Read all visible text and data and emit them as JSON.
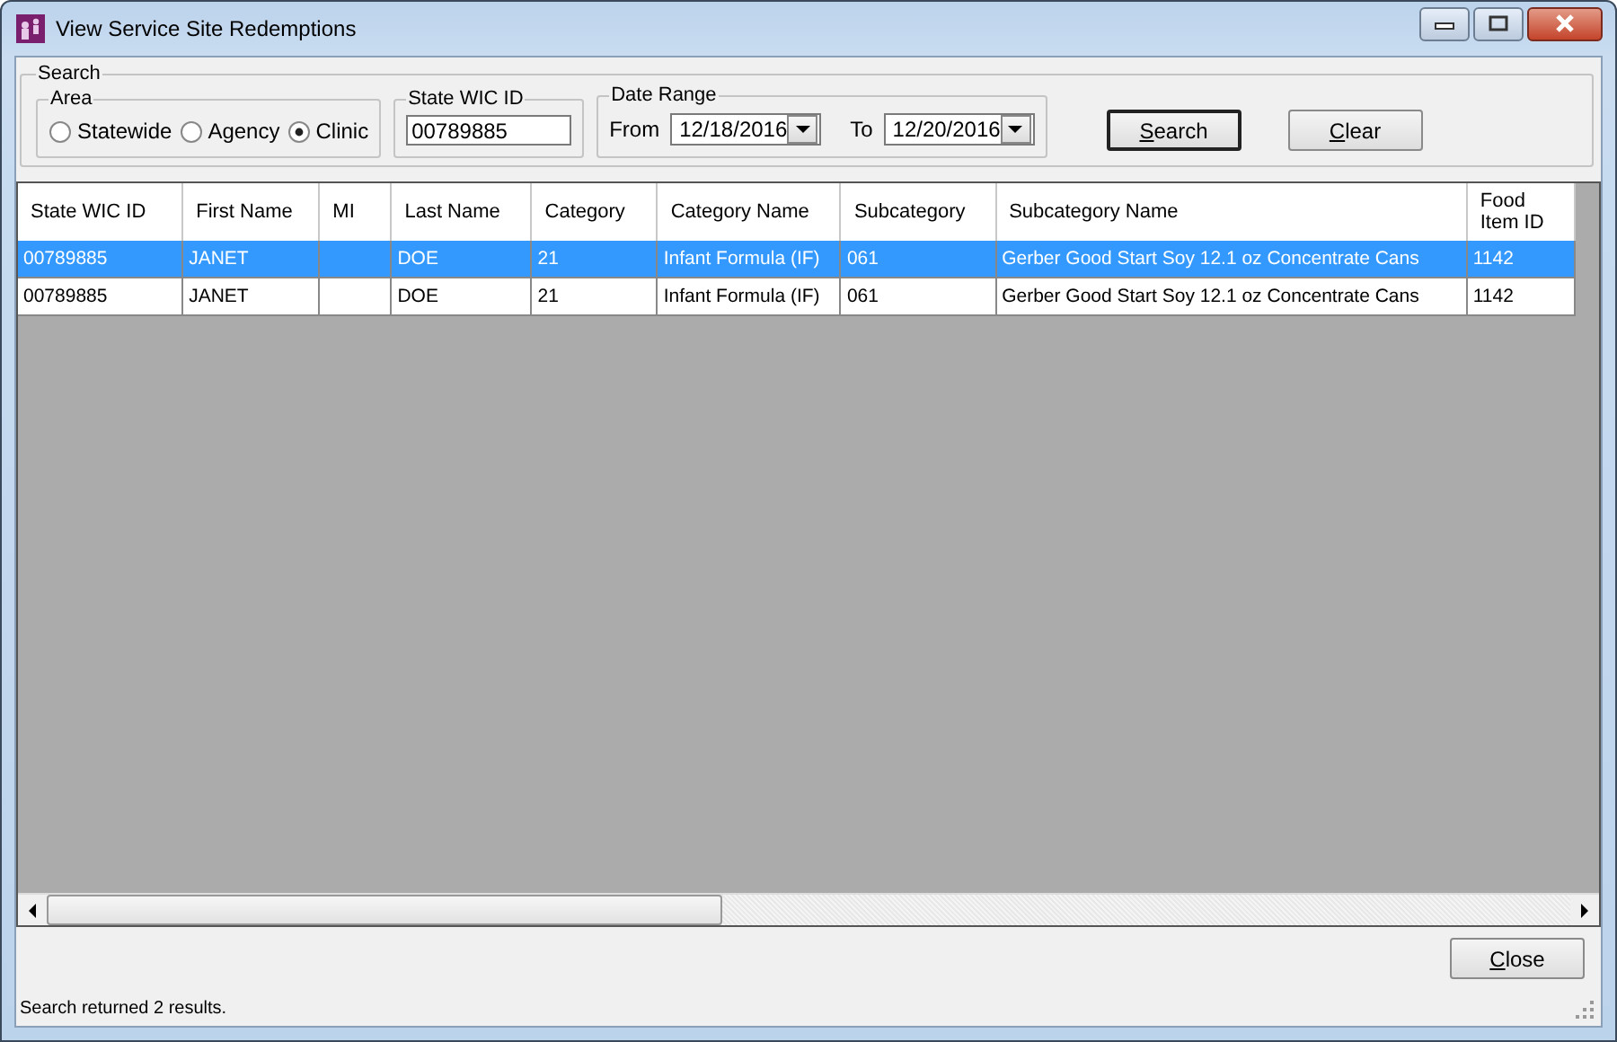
{
  "window": {
    "title": "View Service Site Redemptions"
  },
  "search": {
    "title": "Search",
    "area": {
      "label": "Area",
      "options": [
        {
          "label": "Statewide",
          "selected": false
        },
        {
          "label": "Agency",
          "selected": false
        },
        {
          "label": "Clinic",
          "selected": true
        }
      ]
    },
    "state_wic_id": {
      "label": "State WIC ID",
      "value": "00789885"
    },
    "date_range": {
      "label": "Date Range",
      "from_label": "From",
      "from_value": "12/18/2016",
      "to_label": "To",
      "to_value": "12/20/2016"
    },
    "buttons": [
      {
        "label": "Search",
        "default": true
      },
      {
        "label": "Clear",
        "default": false
      }
    ]
  },
  "table": {
    "columns": [
      "State WIC ID",
      "First Name",
      "MI",
      "Last Name",
      "Category",
      "Category Name",
      "Subcategory",
      "Subcategory Name",
      "Food Item ID"
    ],
    "rows": [
      {
        "selected": true,
        "cells": [
          "00789885",
          "JANET",
          "",
          "DOE",
          "21",
          "Infant Formula (IF)",
          "061",
          "Gerber Good Start Soy 12.1 oz Concentrate Cans",
          "1142"
        ]
      },
      {
        "selected": false,
        "cells": [
          "00789885",
          "JANET",
          "",
          "DOE",
          "21",
          "Infant Formula (IF)",
          "061",
          "Gerber Good Start Soy 12.1 oz Concentrate Cans",
          "1142"
        ]
      }
    ]
  },
  "close_button": "Close",
  "status_bar": "Search returned 2 results."
}
